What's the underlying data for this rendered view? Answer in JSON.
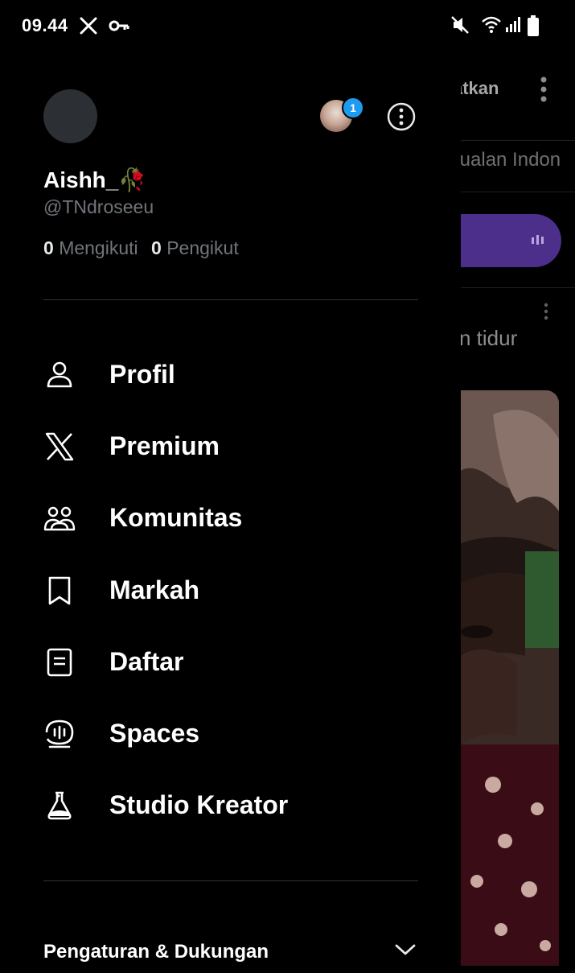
{
  "status_bar": {
    "time": "09.44",
    "icons": [
      "x-logo-icon",
      "vpn-key-icon",
      "mute-icon",
      "wifi-icon",
      "signal-icon",
      "battery-icon"
    ]
  },
  "profile": {
    "display_name": "Aishh_🥀",
    "handle": "@TNdroseeu",
    "following_count": "0",
    "following_label": "Mengikuti",
    "followers_count": "0",
    "followers_label": "Pengikut",
    "account_switch_badge": "1"
  },
  "menu": [
    {
      "label": "Profil",
      "icon": "person-icon"
    },
    {
      "label": "Premium",
      "icon": "x-logo-icon"
    },
    {
      "label": "Komunitas",
      "icon": "communities-icon"
    },
    {
      "label": "Markah",
      "icon": "bookmark-icon"
    },
    {
      "label": "Daftar",
      "icon": "list-icon"
    },
    {
      "label": "Spaces",
      "icon": "spaces-icon"
    },
    {
      "label": "Studio Kreator",
      "icon": "flask-icon"
    }
  ],
  "settings": {
    "label": "Pengaturan & Dukungan",
    "icon": "chevron-down-icon"
  },
  "background_feed": {
    "title_fragment": "atkan",
    "tab_fragment": "tualan Indon",
    "post_text_fragment": "n tidur"
  },
  "colors": {
    "background": "#000000",
    "accent": "#1d9bf0",
    "text_primary": "#e7e9ea",
    "text_secondary": "#71767b",
    "spaces_pill": "#4b2f8a"
  }
}
